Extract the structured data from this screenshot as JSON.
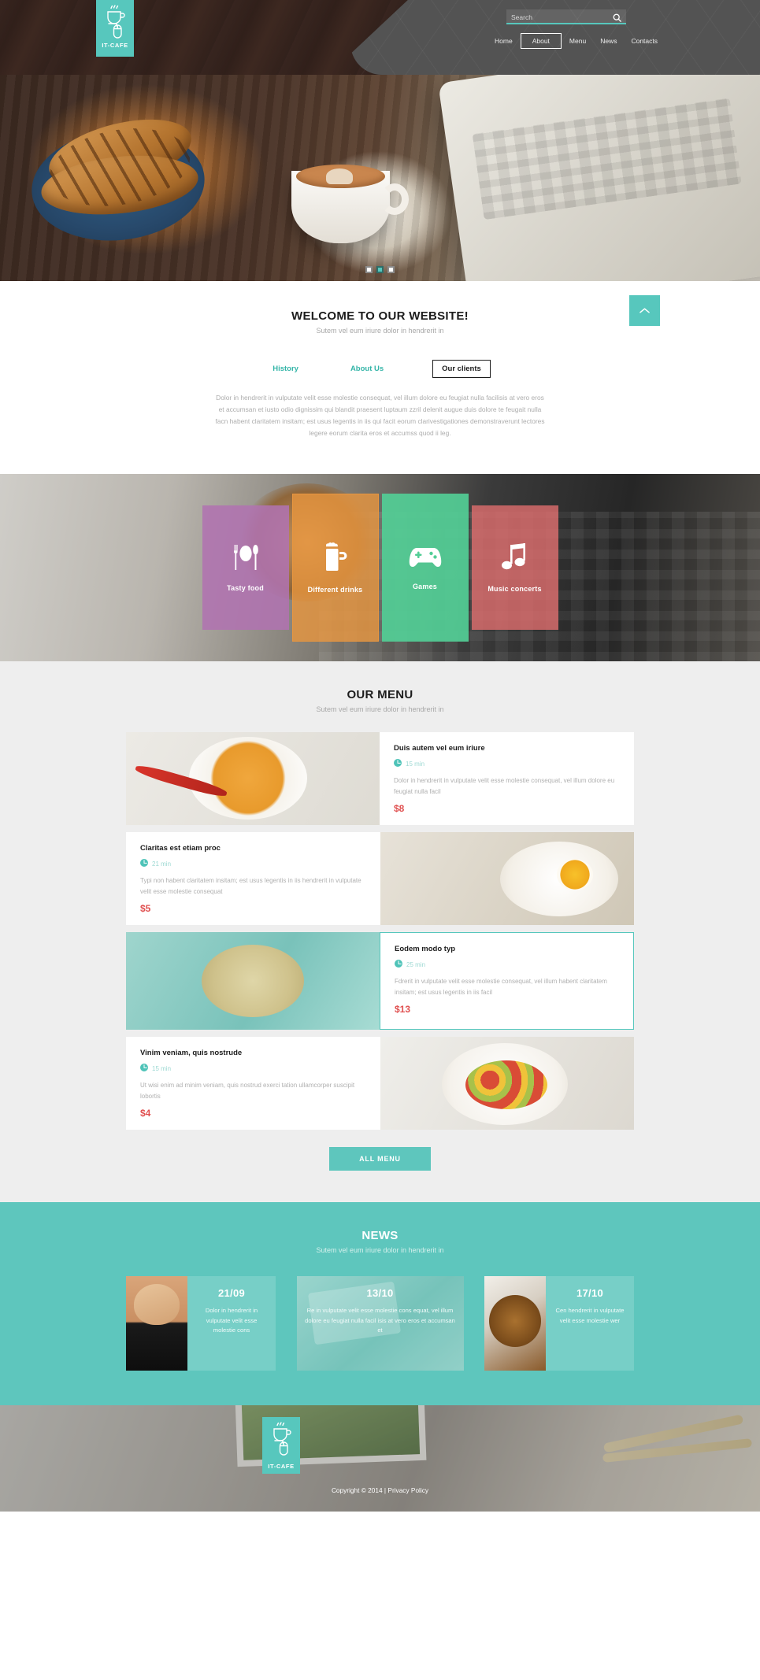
{
  "brand": {
    "logo_text": "IT-CAFE",
    "logo_icon": "coffee-cup-mouse-icon",
    "accent_color": "#57c7bd"
  },
  "header": {
    "search": {
      "placeholder": "Search",
      "value": "",
      "icon": "search-icon"
    },
    "nav": [
      {
        "label": "Home",
        "active": false
      },
      {
        "label": "About",
        "active": true
      },
      {
        "label": "Menu",
        "active": false
      },
      {
        "label": "News",
        "active": false
      },
      {
        "label": "Contacts",
        "active": false
      }
    ]
  },
  "hero": {
    "slides_total": 3,
    "active_slide": 2
  },
  "welcome": {
    "title": "WELCOME TO OUR WEBSITE!",
    "subtitle": "Sutem vel eum iriure dolor in hendrerit in",
    "tabs": [
      {
        "label": "History",
        "active": false
      },
      {
        "label": "About Us",
        "active": false
      },
      {
        "label": "Our clients",
        "active": true
      }
    ],
    "body": "Dolor in hendrerit in vulputate velit esse molestie consequat, vel illum dolore eu feugiat nulla facilisis at vero eros et accumsan et iusto odio dignissim qui blandit praesent luptaum zzril delenit augue duis dolore te feugait nulla facn habent claritatem insitam; est usus legentis in iis qui facit eorum clarivestigationes demonstraverunt lectores legere  eorum clarita eros et accumss quod ii leg.",
    "scroll_top_icon": "chevron-up-icon"
  },
  "services": [
    {
      "label": "Tasty food",
      "icon": "cutlery-icon",
      "color": "#b173b1"
    },
    {
      "label": "Different drinks",
      "icon": "beer-mug-icon",
      "color": "#e8963f"
    },
    {
      "label": "Games",
      "icon": "gamepad-icon",
      "color": "#53ce96"
    },
    {
      "label": "Music concerts",
      "icon": "music-note-icon",
      "color": "#e06e6e"
    }
  ],
  "menu": {
    "title": "OUR MENU",
    "subtitle": "Sutem vel eum iriure dolor in hendrerit in",
    "button_label": "ALL MENU",
    "clock_icon": "clock-icon",
    "items": [
      {
        "name": "Duis autem vel eum iriure",
        "time": "15 min",
        "desc": "Dolor in hendrerit in vulputate velit esse molestie consequat, vel illum dolore eu feugiat nulla facil",
        "price": "$8",
        "image_first": true,
        "hovered": false
      },
      {
        "name": "Claritas est etiam proc",
        "time": "21 min",
        "desc": "Typi non habent claritatem insitam; est usus legentis in iis hendrerit in vulputate velit esse molestie consequat",
        "price": "$5",
        "image_first": false,
        "hovered": false
      },
      {
        "name": "Eodem modo typ",
        "time": "25 min",
        "desc": "Fdrerit in vulputate velit esse molestie consequat, vel illum habent claritatem insitam; est usus legentis in iis facil",
        "price": "$13",
        "image_first": true,
        "hovered": true
      },
      {
        "name": "Vinim veniam, quis nostrude",
        "time": "15 min",
        "desc": "Ut wisi enim ad minim veniam, quis nostrud exerci tation ullamcorper suscipit lobortis",
        "price": "$4",
        "image_first": false,
        "hovered": false
      }
    ]
  },
  "news": {
    "title": "NEWS",
    "subtitle": "Sutem vel eum iriure dolor in hendrerit in",
    "items": [
      {
        "date": "21/09",
        "text": "Dolor in hendrerit in vulputate velit esse molestie cons"
      },
      {
        "date": "13/10",
        "text": "Re in vulputate velit esse molestie cons equat, vel illum dolore eu feugiat nulla facil isis at vero eros et accumsan et"
      },
      {
        "date": "17/10",
        "text": "Cen hendrerit in vulputate velit esse molestie wer"
      }
    ]
  },
  "footer": {
    "copyright": "Copyright © 2014 |",
    "privacy": "Privacy Policy"
  }
}
